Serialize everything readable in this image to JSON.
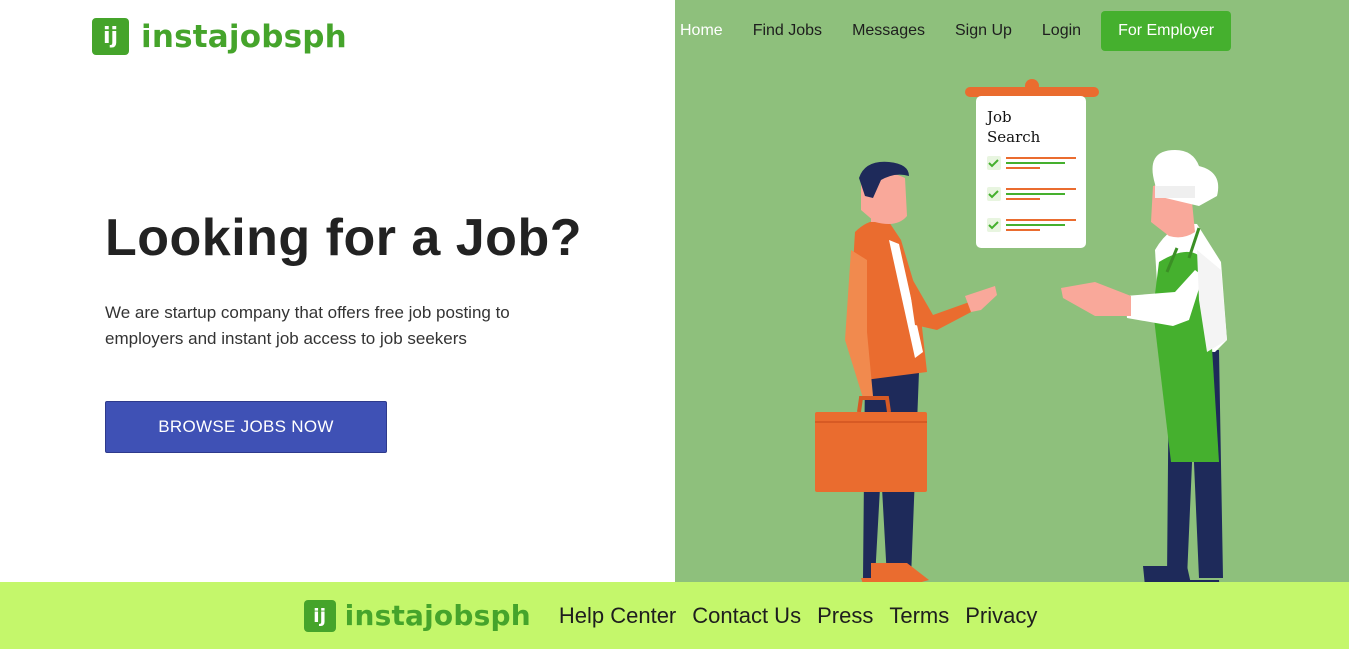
{
  "brand": {
    "mark": "ij",
    "name": "instajobsph",
    "color": "#45a42b"
  },
  "nav": {
    "items": [
      {
        "label": "Home",
        "active": true
      },
      {
        "label": "Find Jobs"
      },
      {
        "label": "Messages"
      },
      {
        "label": "Sign Up"
      },
      {
        "label": "Login"
      }
    ],
    "employer_label": "For Employer"
  },
  "hero": {
    "title": "Looking for a Job?",
    "subtitle": "We are startup company that offers free job posting to employers and instant job access to job seekers",
    "cta_label": "BROWSE JOBS NOW"
  },
  "illustration": {
    "board_line1": "Job",
    "board_line2": "Search"
  },
  "footer": {
    "links": [
      "Help Center",
      "Contact Us",
      "Press",
      "Terms",
      "Privacy"
    ]
  },
  "colors": {
    "accent_green": "#45b02e",
    "illustration_bg": "#8ec07c",
    "footer_bg": "#c4f76b",
    "cta_blue": "#3f51b5",
    "orange": "#ea6c2f"
  }
}
